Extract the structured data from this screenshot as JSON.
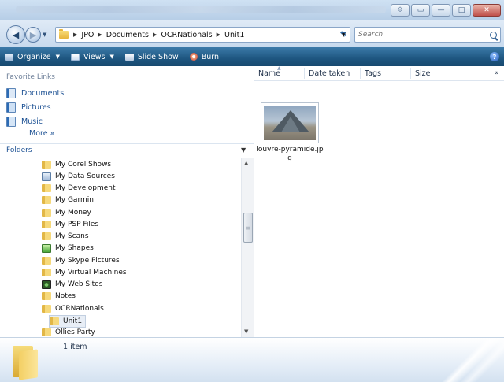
{
  "window": {
    "caption_buttons": [
      "⟐",
      "▭",
      "—",
      "□",
      "✕"
    ]
  },
  "address": {
    "crumbs": [
      "JPO",
      "Documents",
      "OCRNationals",
      "Unit1"
    ],
    "search_placeholder": "Search"
  },
  "toolbar": {
    "organize": "Organize",
    "views": "Views",
    "slideshow": "Slide Show",
    "burn": "Burn",
    "help": "?"
  },
  "favorites": {
    "title": "Favorite Links",
    "items": [
      "Documents",
      "Pictures",
      "Music"
    ],
    "more": "More »"
  },
  "folders": {
    "title": "Folders",
    "items": [
      {
        "label": "My Corel Shows",
        "icon": "folder-icon"
      },
      {
        "label": "My Data Sources",
        "icon": "data-sources-icon"
      },
      {
        "label": "My Development",
        "icon": "folder-icon"
      },
      {
        "label": "My Garmin",
        "icon": "folder-icon"
      },
      {
        "label": "My Money",
        "icon": "folder-icon"
      },
      {
        "label": "My PSP Files",
        "icon": "folder-icon"
      },
      {
        "label": "My Scans",
        "icon": "folder-icon"
      },
      {
        "label": "My Shapes",
        "icon": "shapes-icon"
      },
      {
        "label": "My Skype Pictures",
        "icon": "folder-icon"
      },
      {
        "label": "My Virtual Machines",
        "icon": "folder-icon"
      },
      {
        "label": "My Web Sites",
        "icon": "web-sites-icon"
      },
      {
        "label": "Notes",
        "icon": "folder-icon"
      },
      {
        "label": "OCRNationals",
        "icon": "folder-icon"
      },
      {
        "label": "Unit1",
        "icon": "folder-icon"
      },
      {
        "label": "Ollies Party",
        "icon": "folder-icon"
      }
    ]
  },
  "columns": [
    "Name",
    "Date taken",
    "Tags",
    "Size",
    "»"
  ],
  "files": [
    {
      "name": "louvre-pyramide.jpg"
    }
  ],
  "status": {
    "count": "1 item"
  },
  "colors": {
    "toolbar": "#1e5680",
    "link": "#1a4f92"
  }
}
